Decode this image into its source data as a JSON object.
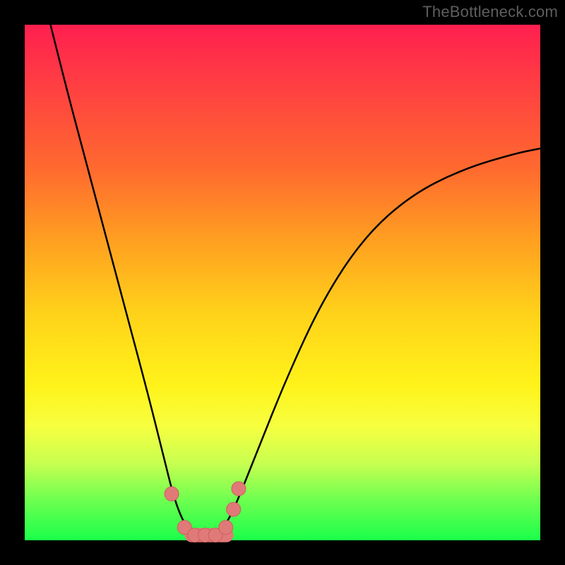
{
  "watermark": "TheBottleneck.com",
  "colors": {
    "frame": "#000000",
    "gradient_top": "#ff1f4f",
    "gradient_mid": "#fff31a",
    "gradient_bottom": "#1aff4a",
    "curve": "#000000",
    "marker_fill": "#e07a78",
    "marker_stroke": "#c95f5d"
  },
  "chart_data": {
    "type": "line",
    "title": "",
    "xlabel": "",
    "ylabel": "",
    "xlim": [
      0,
      100
    ],
    "ylim": [
      0,
      100
    ],
    "grid": false,
    "legend": false,
    "annotations": [
      "TheBottleneck.com"
    ],
    "series": [
      {
        "name": "bottleneck-curve",
        "x": [
          5,
          8,
          12,
          16,
          20,
          24,
          27,
          29,
          31,
          33,
          35,
          37,
          39,
          41,
          45,
          51,
          58,
          66,
          75,
          85,
          95,
          100
        ],
        "y": [
          100,
          88,
          73,
          58,
          43,
          28,
          16,
          8,
          3,
          1,
          1,
          1,
          3,
          7,
          17,
          32,
          47,
          59,
          67,
          72,
          75,
          76
        ]
      },
      {
        "name": "trough-markers",
        "x": [
          28.5,
          31,
          33,
          35,
          37,
          39,
          40.5,
          41.5
        ],
        "y": [
          9,
          2.5,
          1,
          1,
          1,
          2.5,
          6,
          10
        ]
      }
    ]
  }
}
